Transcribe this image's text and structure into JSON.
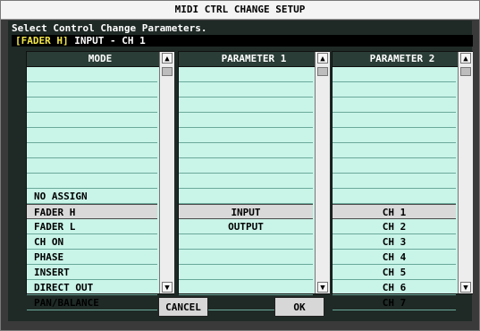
{
  "window": {
    "title": "MIDI CTRL CHANGE SETUP",
    "prompt": "Select Control Change Parameters.",
    "status_highlight": "[FADER H]",
    "status_text": " INPUT - CH 1"
  },
  "columns": [
    {
      "header": "MODE",
      "items": [
        "",
        "",
        "",
        "",
        "",
        "",
        "",
        "",
        "NO ASSIGN",
        "FADER H",
        "FADER L",
        "CH ON",
        "PHASE",
        "INSERT",
        "DIRECT OUT",
        "PAN/BALANCE"
      ],
      "selected_index": 9
    },
    {
      "header": "PARAMETER 1",
      "items": [
        "",
        "",
        "",
        "",
        "",
        "",
        "",
        "",
        "",
        "INPUT",
        "OUTPUT",
        "",
        "",
        "",
        "",
        ""
      ],
      "selected_index": 9
    },
    {
      "header": "PARAMETER 2",
      "items": [
        "",
        "",
        "",
        "",
        "",
        "",
        "",
        "",
        "",
        "CH 1",
        "CH 2",
        "CH 3",
        "CH 4",
        "CH 5",
        "CH 6",
        "CH 7"
      ],
      "selected_index": 9
    }
  ],
  "buttons": {
    "cancel": "CANCEL",
    "ok": "OK"
  }
}
